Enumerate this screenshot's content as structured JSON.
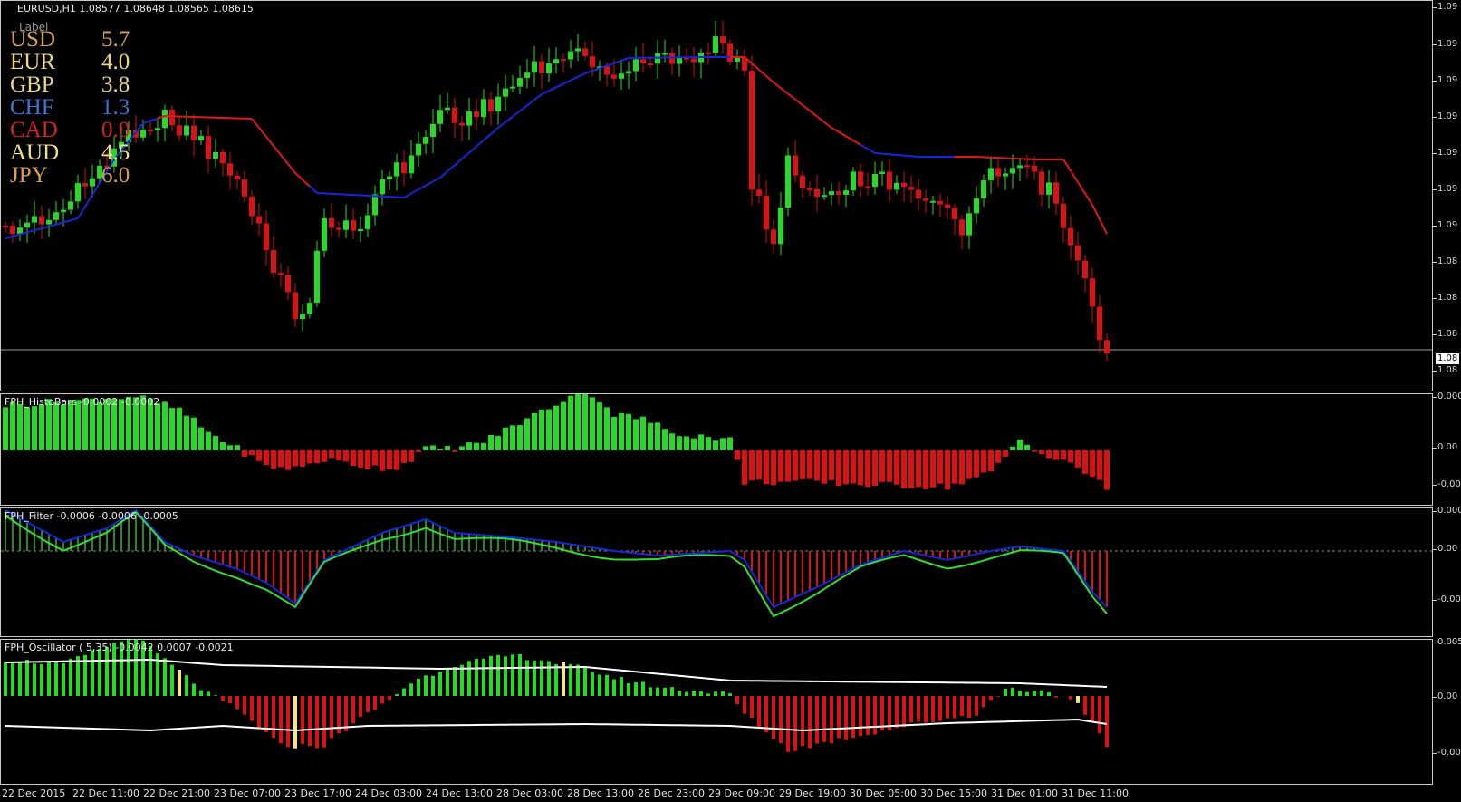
{
  "header": {
    "symbol_info": "EURUSD,H1  1.08577 1.08648 1.08565 1.08615"
  },
  "strength_label": "Label",
  "currency_strength": [
    {
      "currency": "USD",
      "value": "5.7",
      "color": "#d2a05a"
    },
    {
      "currency": "EUR",
      "value": "4.0",
      "color": "#f0d97a"
    },
    {
      "currency": "GBP",
      "value": "3.8",
      "color": "#e6d48a"
    },
    {
      "currency": "CHF",
      "value": "1.3",
      "color": "#3a78d8"
    },
    {
      "currency": "CAD",
      "value": "0.0",
      "color": "#d8221c"
    },
    {
      "currency": "AUD",
      "value": "4.5",
      "color": "#f0e08a"
    },
    {
      "currency": "JPY",
      "value": "6.0",
      "color": "#d6a050"
    }
  ],
  "price_axis": [
    "1.09",
    "1.09",
    "1.09",
    "1.09",
    "1.09",
    "1.09",
    "1.09",
    "1.08",
    "1.08",
    "1.08",
    "1.08"
  ],
  "current_price_tag": "1.08",
  "panels": {
    "histobars": {
      "title": "FPH_HistoBars -0.0002 -0.0002",
      "axis": [
        "0.000",
        "0.00",
        "-0.00"
      ]
    },
    "filter": {
      "title": "FPH_Filter -0.0006 -0.0006 -0.0005",
      "axis": [
        "0.000",
        "0.00",
        "-0.00"
      ]
    },
    "oscillator": {
      "title": "FPH_Oscillator ( 5,35) -0.0042 0.0007 -0.0021",
      "axis": [
        "0.005",
        "0.00",
        "-0.00"
      ]
    }
  },
  "time_axis": [
    "22 Dec 2015",
    "22 Dec 11:00",
    "22 Dec 21:00",
    "23 Dec 07:00",
    "23 Dec 17:00",
    "24 Dec 03:00",
    "24 Dec 13:00",
    "28 Dec 03:00",
    "28 Dec 13:00",
    "28 Dec 23:00",
    "29 Dec 09:00",
    "29 Dec 19:00",
    "30 Dec 05:00",
    "30 Dec 15:00",
    "31 Dec 01:00",
    "31 Dec 11:00"
  ],
  "colors": {
    "bull": "#22dd22",
    "bear": "#dd1111",
    "ma_blue": "#1428d8",
    "ma_red": "#e01818",
    "osc_line": "#ffffff",
    "signal": "#f4e58a",
    "filter_green": "#33dd33"
  }
}
